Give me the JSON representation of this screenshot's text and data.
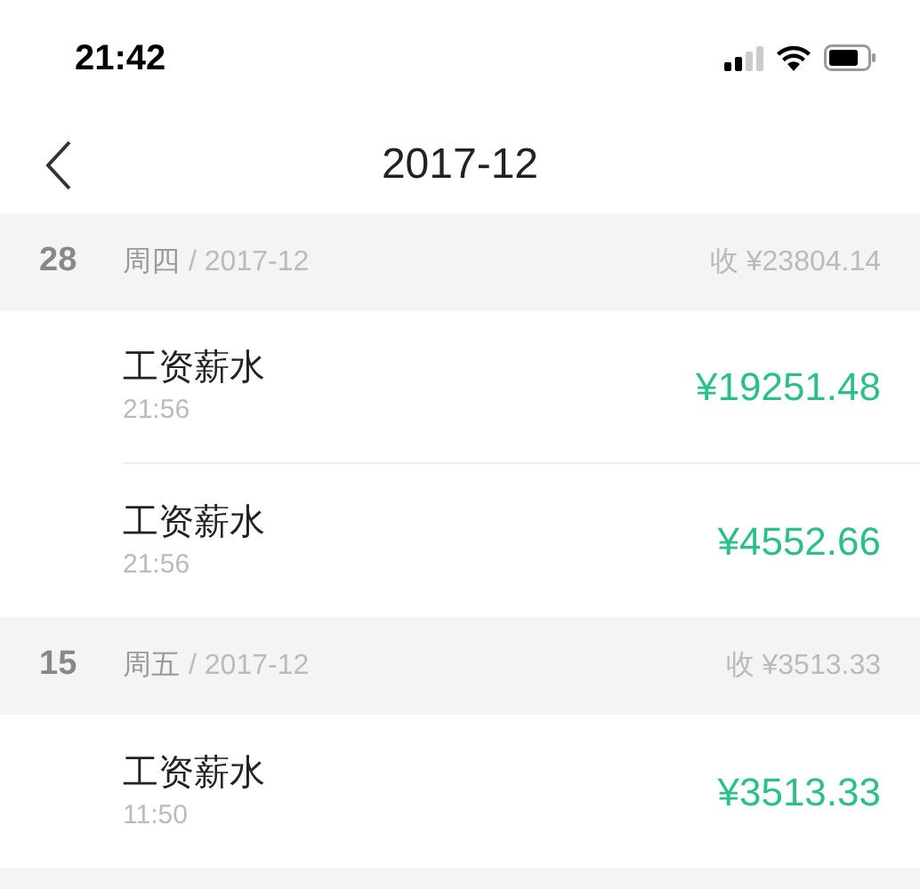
{
  "status_bar": {
    "time": "21:42"
  },
  "nav": {
    "title": "2017-12"
  },
  "groups": [
    {
      "day": "28",
      "weekday": "周四",
      "month": "/ 2017-12",
      "total": "收 ¥23804.14",
      "entries": [
        {
          "title": "工资薪水",
          "time": "21:56",
          "amount": "¥19251.48"
        },
        {
          "title": "工资薪水",
          "time": "21:56",
          "amount": "¥4552.66"
        }
      ]
    },
    {
      "day": "15",
      "weekday": "周五",
      "month": "/ 2017-12",
      "total": "收 ¥3513.33",
      "entries": [
        {
          "title": "工资薪水",
          "time": "11:50",
          "amount": "¥3513.33"
        }
      ]
    }
  ]
}
